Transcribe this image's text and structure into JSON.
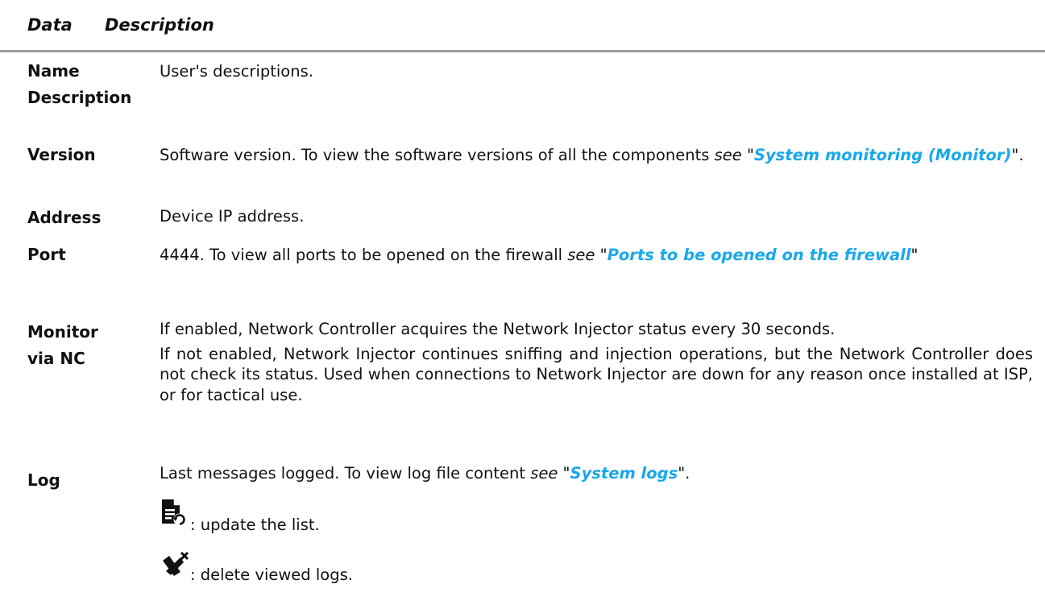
{
  "header": {
    "col_data": "Data",
    "col_description": "Description"
  },
  "rows": [
    {
      "term": "Name Description",
      "desc": "User's descriptions."
    },
    {
      "term": "Version",
      "desc": "Software version. To view the software versions of all the components",
      "see": "see",
      "link": "System monitoring (Monitor)",
      "tail": "\"."
    },
    {
      "term": "Address",
      "desc": "Device IP address."
    },
    {
      "term": "Port",
      "desc": "4444. To view all ports to be opened on the firewall",
      "see": "see",
      "link": "Ports to be opened on the firewall",
      "tail": "\""
    },
    {
      "term": "Monitor via NC",
      "desc": "If enabled, Network Controller acquires the Network Injector status every 30 seconds.",
      "desc2": "If not enabled, Network Injector continues sniffing and injection operations, but the Network Controller does not check its status. Used when connections to Network Injector are down for any reason once installed at ISP, or for tactical use."
    },
    {
      "term": "Log",
      "desc": "Last messages logged. To view log file content",
      "see": "see",
      "link": "System logs",
      "tail": "\".",
      "actions": [
        {
          "icon": "refresh-log-icon",
          "label": ": update the list."
        },
        {
          "icon": "delete-logs-icon",
          "label": ": delete viewed logs."
        }
      ]
    }
  ]
}
